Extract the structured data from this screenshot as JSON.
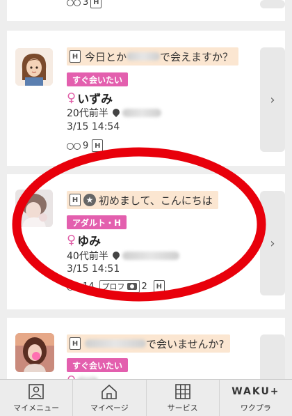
{
  "cards": [
    {
      "stats": {
        "footprints": "3"
      }
    },
    {
      "subject_pre": "今日とか",
      "subject_post": "で会えますか？",
      "tag": "すぐ会いたい",
      "gender_icon": "♀",
      "name": "いずみ",
      "age": "20代前半",
      "date": "3/15 14:54",
      "stats": {
        "footprints": "9"
      },
      "chevron": "›"
    },
    {
      "subject": "初めまして、こんにちは",
      "tag": "アダルト・H",
      "gender_icon": "♀",
      "name": "ゆみ",
      "age": "40代前半",
      "date": "3/15 14:51",
      "stats": {
        "footprints": "14",
        "prof_label": "プロフ",
        "photos": "2"
      },
      "chevron": "›"
    },
    {
      "subject_post": "で会いませんか?",
      "tag": "すぐ会いたい",
      "gender_icon": "♀"
    }
  ],
  "h_icon": "H",
  "star_icon": "★",
  "nav": [
    {
      "label": "マイメニュー",
      "icon": "person-icon"
    },
    {
      "label": "マイページ",
      "icon": "home-icon"
    },
    {
      "label": "サービス",
      "icon": "grid-icon"
    },
    {
      "label": "ワクプラ",
      "logo": "WAKU+"
    }
  ],
  "colors": {
    "tag_pink": "#e35fae",
    "subject_bg": "#fbe6d1",
    "annotation_red": "#e8000b"
  }
}
